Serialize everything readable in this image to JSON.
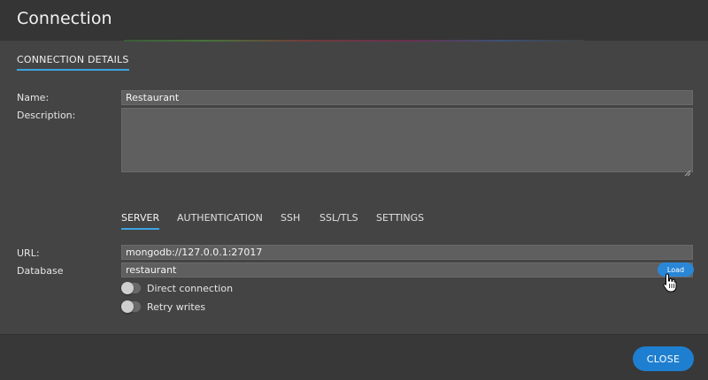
{
  "dialog": {
    "title": "Connection",
    "section_tab": "CONNECTION DETAILS"
  },
  "details": {
    "name_label": "Name:",
    "name_value": "Restaurant",
    "description_label": "Description:",
    "description_value": ""
  },
  "tabs": [
    {
      "label": "SERVER",
      "active": true
    },
    {
      "label": "AUTHENTICATION",
      "active": false
    },
    {
      "label": "SSH",
      "active": false
    },
    {
      "label": "SSL/TLS",
      "active": false
    },
    {
      "label": "SETTINGS",
      "active": false
    }
  ],
  "server": {
    "url_label": "URL:",
    "url_value": "mongodb://127.0.0.1:27017",
    "database_label": "Database",
    "database_value": "restaurant",
    "load_label": "Load",
    "toggles": [
      {
        "label": "Direct connection",
        "on": false
      },
      {
        "label": "Retry writes",
        "on": false
      }
    ]
  },
  "footer": {
    "close_label": "CLOSE"
  },
  "colors": {
    "accent": "#3da4e0",
    "primary_button": "#1e7fd0",
    "background": "#444444"
  },
  "icons": {
    "cursor": "hand-pointer-icon",
    "resize": "resize-grip-icon"
  }
}
